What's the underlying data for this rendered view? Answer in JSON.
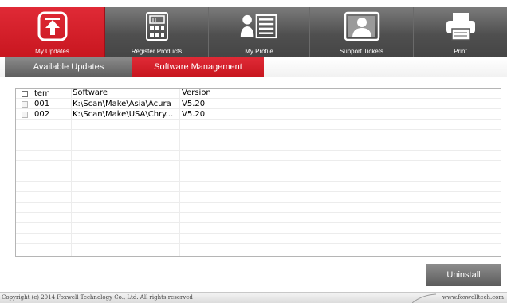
{
  "toolbar": {
    "items": [
      {
        "label": "My Updates",
        "icon": "upload-icon",
        "active": true
      },
      {
        "label": "Register Products",
        "icon": "calculator-icon",
        "active": false
      },
      {
        "label": "My Profile",
        "icon": "profile-icon",
        "active": false
      },
      {
        "label": "Support Tickets",
        "icon": "support-ticket-icon",
        "active": false
      },
      {
        "label": "Print",
        "icon": "printer-icon",
        "active": false
      }
    ]
  },
  "tabs": [
    {
      "label": "Available Updates",
      "active": false
    },
    {
      "label": "Software Management",
      "active": true
    }
  ],
  "table": {
    "headers": {
      "item": "Item",
      "software": "Software",
      "version": "Version"
    },
    "rows": [
      {
        "item": "001",
        "software": "K:\\Scan\\Make\\Asia\\Acura",
        "version": "V5.20"
      },
      {
        "item": "002",
        "software": "K:\\Scan\\Make\\USA\\Chry...",
        "version": "V5.20"
      }
    ]
  },
  "buttons": {
    "uninstall": "Uninstall"
  },
  "footer": {
    "copyright": "Copyright (c) 2014 Foxwell Technology Co., Ltd. All rights reserved",
    "website": "www.foxwelltech.com"
  },
  "colors": {
    "accent": "#d01f29",
    "toolbar": "#4f4f4f",
    "button": "#6f6f6f"
  }
}
